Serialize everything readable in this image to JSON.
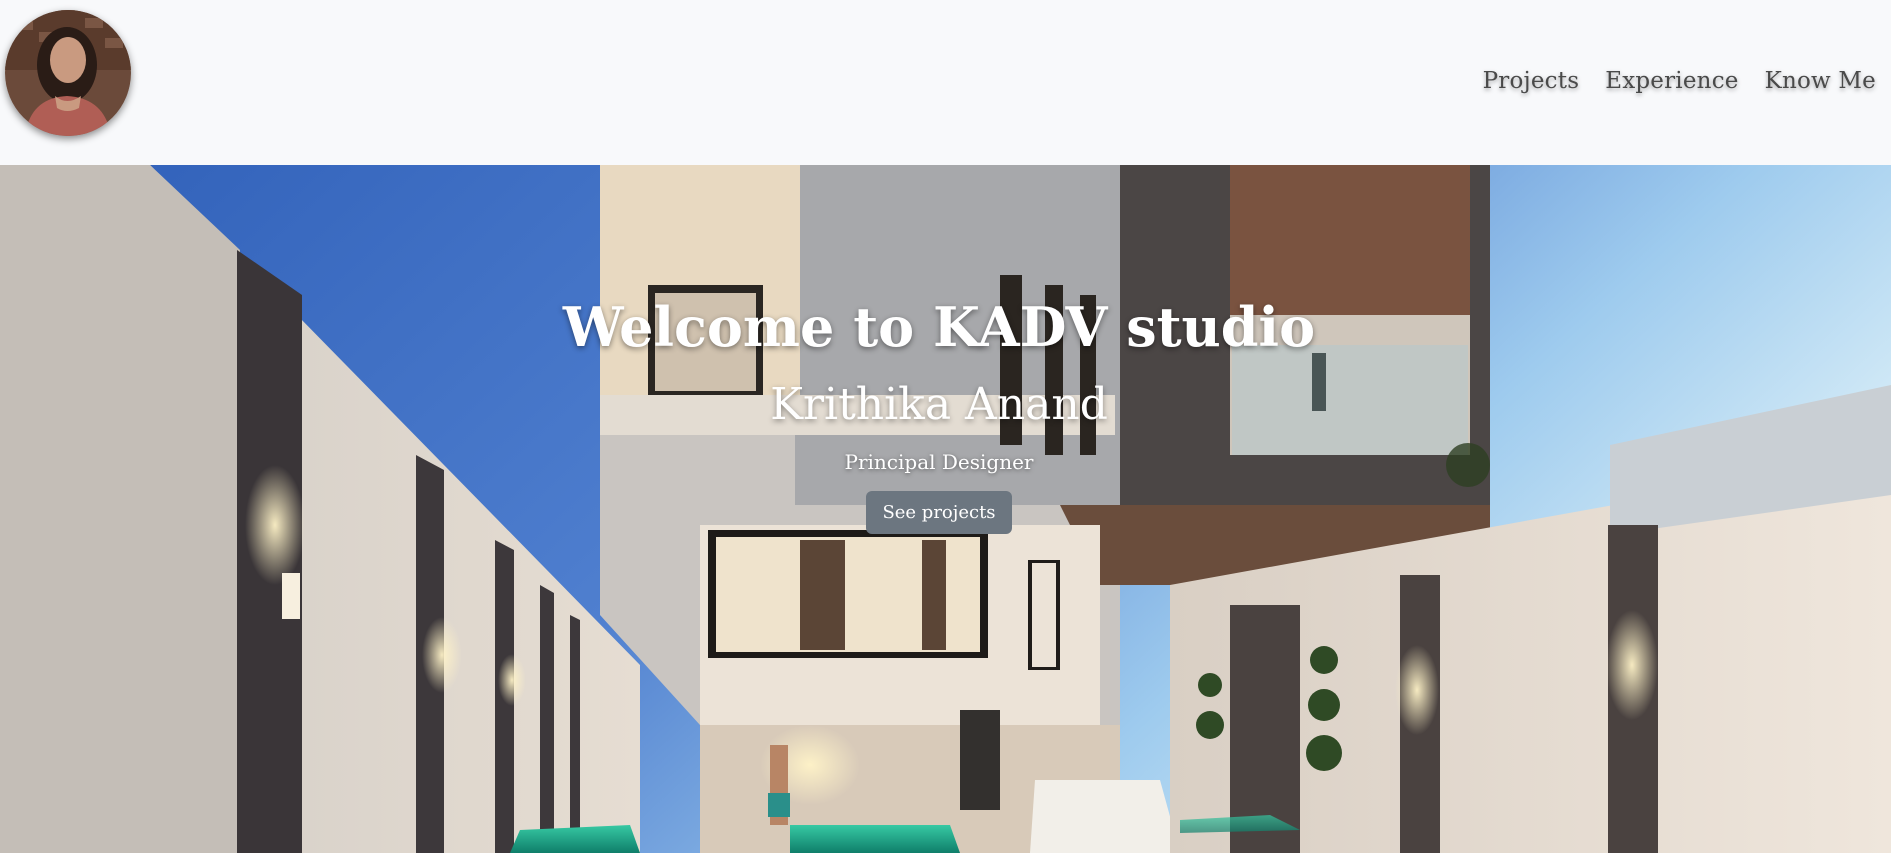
{
  "nav": {
    "avatar_alt": "Krithika Anand portrait",
    "links": [
      "Projects",
      "Experience",
      "Know Me"
    ]
  },
  "hero": {
    "title": "Welcome to KADV studio",
    "name": "Krithika Anand",
    "role": "Principal Designer",
    "button_label": "See projects"
  },
  "colors": {
    "navbar_bg": "#f8f9fb",
    "nav_text": "#4a4a4a",
    "button_bg": "#6c7680",
    "hero_text": "#ffffff"
  }
}
